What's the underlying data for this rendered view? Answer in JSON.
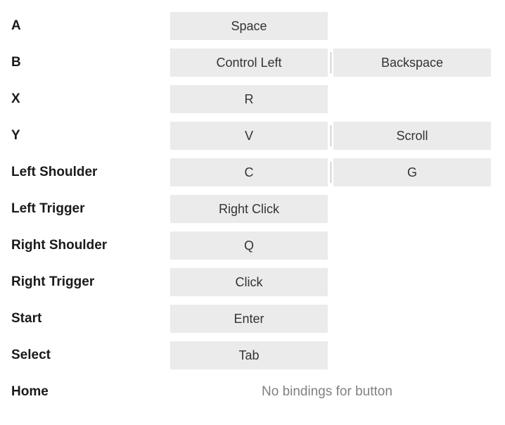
{
  "rows": [
    {
      "label": "A",
      "bindings": [
        "Space"
      ]
    },
    {
      "label": "B",
      "bindings": [
        "Control Left",
        "Backspace"
      ]
    },
    {
      "label": "X",
      "bindings": [
        "R"
      ]
    },
    {
      "label": "Y",
      "bindings": [
        "V",
        "Scroll"
      ]
    },
    {
      "label": "Left Shoulder",
      "bindings": [
        "C",
        "G"
      ]
    },
    {
      "label": "Left Trigger",
      "bindings": [
        "Right Click"
      ]
    },
    {
      "label": "Right Shoulder",
      "bindings": [
        "Q"
      ]
    },
    {
      "label": "Right Trigger",
      "bindings": [
        "Click"
      ]
    },
    {
      "label": "Start",
      "bindings": [
        "Enter"
      ]
    },
    {
      "label": "Select",
      "bindings": [
        "Tab"
      ]
    },
    {
      "label": "Home",
      "bindings": [],
      "empty_text": "No bindings for button"
    }
  ]
}
